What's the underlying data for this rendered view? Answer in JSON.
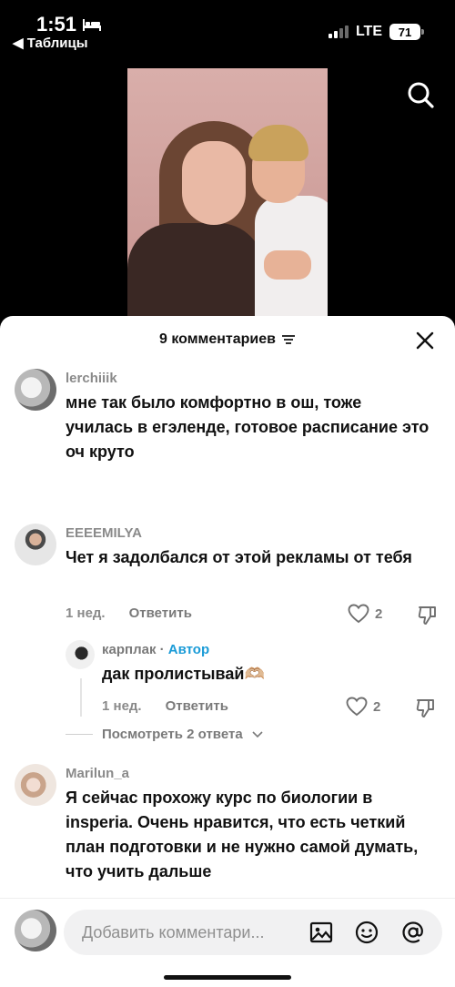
{
  "status_bar": {
    "time": "1:51",
    "back_label": "◀ Таблицы",
    "network": "LTE",
    "battery": "71"
  },
  "comments_sheet": {
    "title": "9 комментариев",
    "comments": [
      {
        "username": "lerchiiik",
        "text": "мне так было комфортно в ош, тоже училась в егэленде, готовое расписание это оч круто"
      },
      {
        "username": "EEEEMILYA",
        "text": "Чет я задолбался от этой рекламы от тебя",
        "time": "1 нед.",
        "reply_label": "Ответить",
        "likes": "2",
        "replies": [
          {
            "username": "карплак",
            "separator": " · ",
            "author_tag": "Автор",
            "text": "дак пролистывай🫶🏼",
            "time": "1 нед.",
            "reply_label": "Ответить",
            "likes": "2"
          }
        ],
        "view_more": "Посмотреть 2 ответа"
      },
      {
        "username": "Marilun_a",
        "text": "Я сейчас прохожу курс по биологии в insperia. Очень нравится, что есть четкий план подготовки и не нужно самой думать, что учить дальше"
      }
    ]
  },
  "composer": {
    "placeholder": "Добавить комментари..."
  },
  "icons": {
    "search": "search-icon",
    "close": "close-icon",
    "heart": "heart-icon",
    "dislike": "thumbs-down-icon",
    "image": "image-icon",
    "emoji": "emoji-icon",
    "mention": "at-icon"
  }
}
